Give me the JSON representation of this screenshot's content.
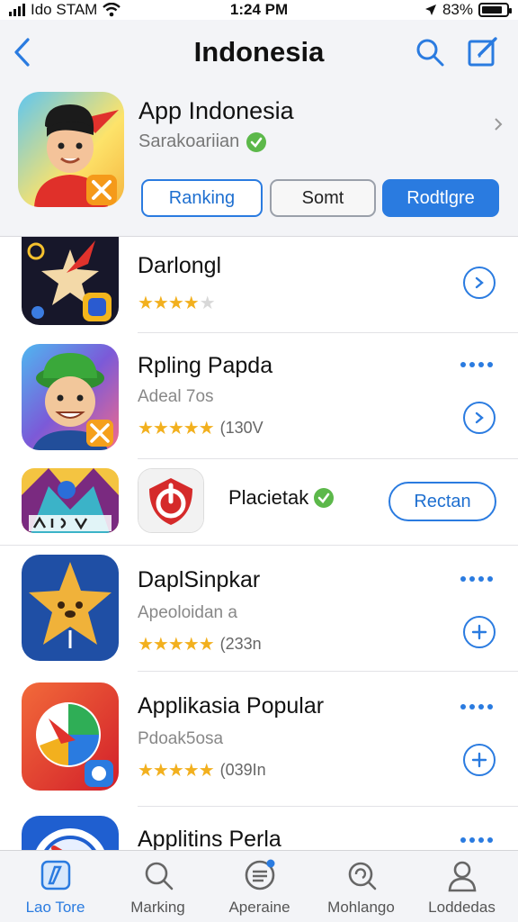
{
  "status_bar": {
    "carrier": "Ido STAM",
    "time": "1:24 PM",
    "battery": "83%",
    "battery_level": 0.83
  },
  "nav": {
    "title": "Indonesia",
    "back_icon": "chevron-left-icon",
    "search_icon": "search-icon",
    "edit_icon": "compose-icon"
  },
  "featured": {
    "title": "App Indonesia",
    "subtitle": "Sarakoariian",
    "segments": [
      "Ranking",
      "Somt",
      "Rodtlgre"
    ],
    "active_segment": "Rodtlgre"
  },
  "apps": [
    {
      "title": "Darlongl",
      "subtitle": "",
      "rating": 3.5,
      "count": "",
      "action": "arrow"
    },
    {
      "title": "Rpling Papda",
      "subtitle": "Adeal 7os",
      "rating": 4.5,
      "count": "(130V",
      "action": "arrow"
    },
    {
      "title": "Placietak",
      "subtitle": "",
      "rating": null,
      "count": "",
      "action": "Rectan"
    },
    {
      "title": "DaplSinpkar",
      "subtitle": "Apeoloidan a",
      "rating": 4.5,
      "count": "(233n",
      "action": "plus"
    },
    {
      "title": "Applikasia Popular",
      "subtitle": "Pdoak5osa",
      "rating": 5,
      "count": "(039In",
      "action": "plus"
    },
    {
      "title": "Applitins Perla",
      "subtitle": "",
      "rating": null,
      "count": "",
      "action": "more"
    }
  ],
  "tabs": [
    {
      "label": "Lao Tore",
      "icon": "today-icon",
      "active": true
    },
    {
      "label": "Marking",
      "icon": "search-icon",
      "active": false
    },
    {
      "label": "Aperaine",
      "icon": "apps-icon",
      "active": false
    },
    {
      "label": "Mohlango",
      "icon": "refresh-search-icon",
      "active": false
    },
    {
      "label": "Loddedas",
      "icon": "profile-icon",
      "active": false
    }
  ],
  "colors": {
    "accent": "#2a7be0",
    "star": "#f2b01e",
    "verified": "#5cb84a",
    "header_bg": "#f3f4f7"
  }
}
